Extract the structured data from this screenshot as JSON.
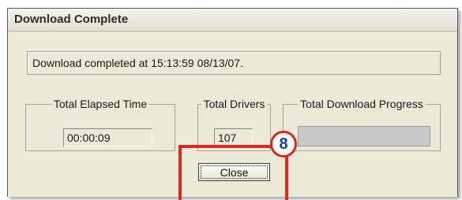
{
  "window": {
    "title": "Download Complete"
  },
  "status": {
    "message": "Download completed at 15:13:59 08/13/07."
  },
  "groups": {
    "elapsed": {
      "label": "Total Elapsed Time",
      "value": "00:00:09"
    },
    "drivers": {
      "label": "Total Drivers",
      "value": "107"
    },
    "progress": {
      "label": "Total Download Progress",
      "percent": 100,
      "bar_color": "#c9c9c9"
    }
  },
  "buttons": {
    "close_label": "Close"
  },
  "annotation": {
    "step_number": "8",
    "color": "#d62b20"
  }
}
